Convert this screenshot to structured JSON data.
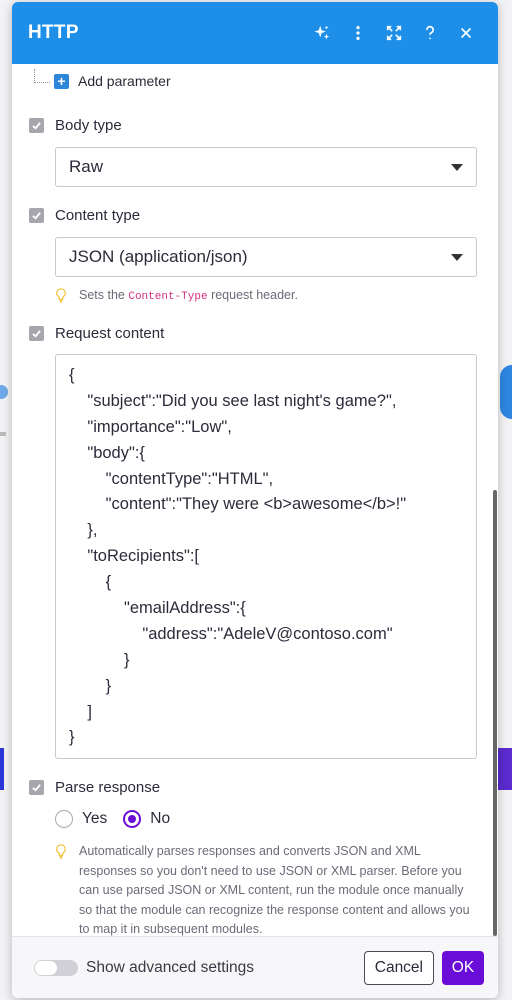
{
  "header": {
    "title": "HTTP",
    "icons": [
      "sparkle-icon",
      "kebab-menu-icon",
      "expand-icon",
      "help-icon",
      "close-icon"
    ],
    "color": "#1e8fe8"
  },
  "add_parameter": {
    "label": "Add parameter"
  },
  "body_type": {
    "label": "Body type",
    "value": "Raw"
  },
  "content_type": {
    "label": "Content type",
    "value": "JSON (application/json)",
    "hint_prefix": "Sets the",
    "hint_code": "Content-Type",
    "hint_suffix": "request header."
  },
  "request_content": {
    "label": "Request content",
    "lines": [
      "{",
      "    \"subject\":\"Did you see last night's game?\",",
      "    \"importance\":\"Low\",",
      "    \"body\":{",
      "        \"contentType\":\"HTML\",",
      "        \"content\":\"They were <b>awesome</b>!\"",
      "    },",
      "    \"toRecipients\":[",
      "        {",
      "            \"emailAddress\":{",
      "                \"address\":\"AdeleV@contoso.com\"",
      "            }",
      "        }",
      "    ]",
      "}"
    ]
  },
  "parse_response": {
    "label": "Parse response",
    "options": [
      "Yes",
      "No"
    ],
    "selected": "No",
    "hint": "Automatically parses responses and converts JSON and XML responses so you don't need to use JSON or XML parser. Before you can use parsed JSON or XML content, run the module once manually so that the module can recognize the response content and allows you to map it in subsequent modules."
  },
  "footer": {
    "advanced_label": "Show advanced settings",
    "advanced_on": false,
    "cancel_label": "Cancel",
    "ok_label": "OK",
    "ok_color": "#6a0dd6"
  }
}
